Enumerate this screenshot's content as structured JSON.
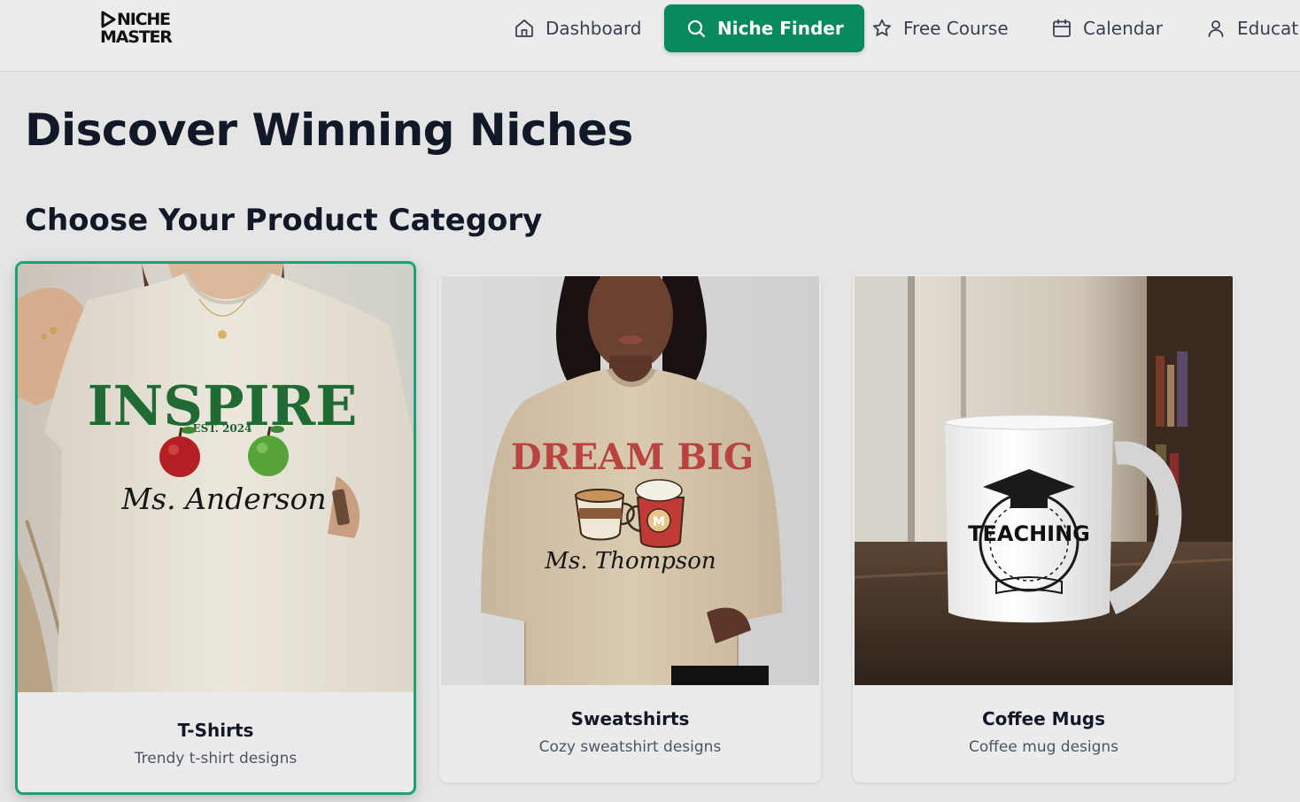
{
  "brand": {
    "line1": "NICHE",
    "line2": "MASTER"
  },
  "nav": {
    "items": [
      {
        "label": "Dashboard",
        "icon": "home-icon",
        "active": false
      },
      {
        "label": "Niche Finder",
        "icon": "search-icon",
        "active": true
      },
      {
        "label": "Free Course",
        "icon": "star-icon",
        "active": false
      },
      {
        "label": "Calendar",
        "icon": "calendar-icon",
        "active": false
      },
      {
        "label": "Education",
        "icon": "user-icon",
        "active": false
      }
    ],
    "active_color": "#088a5c"
  },
  "main": {
    "title": "Discover Winning Niches",
    "section_title": "Choose Your Product Category",
    "categories": [
      {
        "title": "T-Shirts",
        "description": "Trendy t-shirt designs",
        "selected": true,
        "image": {
          "print_headline": "INSPIRE",
          "print_sub": "EST. 2024",
          "print_name": "Ms. Anderson"
        }
      },
      {
        "title": "Sweatshirts",
        "description": "Cozy sweatshirt designs",
        "selected": false,
        "image": {
          "print_headline": "DREAM BIG",
          "print_name": "Ms. Thompson",
          "mug_letter": "M"
        }
      },
      {
        "title": "Coffee Mugs",
        "description": "Coffee mug designs",
        "selected": false,
        "image": {
          "print_headline": "TEACHING"
        }
      }
    ],
    "selected_border_color": "#1aa473"
  }
}
